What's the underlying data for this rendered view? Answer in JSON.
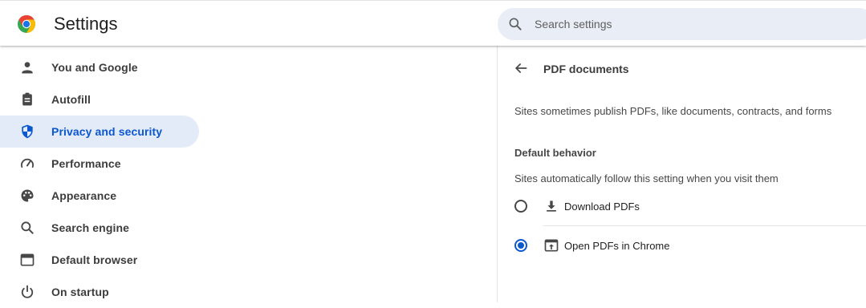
{
  "header": {
    "title": "Settings",
    "search_placeholder": "Search settings"
  },
  "sidebar": {
    "items": [
      {
        "label": "You and Google",
        "icon": "person-icon",
        "active": false
      },
      {
        "label": "Autofill",
        "icon": "clipboard-icon",
        "active": false
      },
      {
        "label": "Privacy and security",
        "icon": "shield-icon",
        "active": true
      },
      {
        "label": "Performance",
        "icon": "speedometer-icon",
        "active": false
      },
      {
        "label": "Appearance",
        "icon": "palette-icon",
        "active": false
      },
      {
        "label": "Search engine",
        "icon": "search-icon",
        "active": false
      },
      {
        "label": "Default browser",
        "icon": "browser-window-icon",
        "active": false
      },
      {
        "label": "On startup",
        "icon": "power-icon",
        "active": false
      }
    ]
  },
  "panel": {
    "title": "PDF documents",
    "description": "Sites sometimes publish PDFs, like documents, contracts, and forms",
    "section_heading": "Default behavior",
    "section_subtext": "Sites automatically follow this setting when you visit them",
    "options": [
      {
        "label": "Download PDFs",
        "icon": "download-icon",
        "checked": false
      },
      {
        "label": "Open PDFs in Chrome",
        "icon": "open-in-browser-icon",
        "checked": true
      }
    ]
  },
  "colors": {
    "accent": "#0b57d0",
    "active_nav_bg": "#e3ebf9",
    "search_bg": "#e9eef6"
  }
}
